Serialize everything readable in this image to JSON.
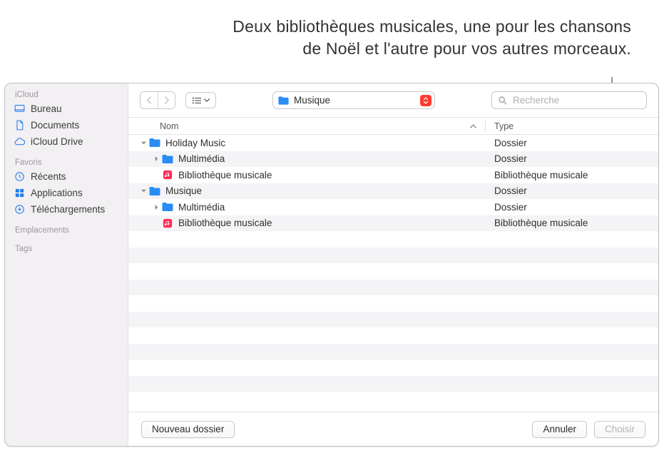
{
  "annotation": "Deux bibliothèques musicales, une pour les chansons de Noël et l'autre pour vos autres morceaux.",
  "sidebar": {
    "sections": [
      {
        "label": "iCloud",
        "items": [
          {
            "id": "bureau",
            "label": "Bureau",
            "icon": "desktop"
          },
          {
            "id": "documents",
            "label": "Documents",
            "icon": "doc"
          },
          {
            "id": "iclouddrive",
            "label": "iCloud Drive",
            "icon": "cloud"
          }
        ]
      },
      {
        "label": "Favoris",
        "items": [
          {
            "id": "recents",
            "label": "Récents",
            "icon": "clock"
          },
          {
            "id": "apps",
            "label": "Applications",
            "icon": "apps"
          },
          {
            "id": "downloads",
            "label": "Téléchargements",
            "icon": "download"
          }
        ]
      },
      {
        "label": "Emplacements",
        "items": []
      },
      {
        "label": "Tags",
        "items": []
      }
    ]
  },
  "toolbar": {
    "path_label": "Musique",
    "search_placeholder": "Recherche"
  },
  "columns": {
    "name": "Nom",
    "type": "Type"
  },
  "rows": [
    {
      "indent": 0,
      "disclosure": "down",
      "icon": "folder",
      "name": "Holiday Music",
      "type": "Dossier"
    },
    {
      "indent": 1,
      "disclosure": "right",
      "icon": "folder",
      "name": "Multimédia",
      "type": "Dossier"
    },
    {
      "indent": 1,
      "disclosure": "none",
      "icon": "musicdb",
      "name": "Bibliothèque musicale",
      "type": "Bibliothèque musicale"
    },
    {
      "indent": 0,
      "disclosure": "down",
      "icon": "folder",
      "name": "Musique",
      "type": "Dossier"
    },
    {
      "indent": 1,
      "disclosure": "right",
      "icon": "folder",
      "name": "Multimédia",
      "type": "Dossier"
    },
    {
      "indent": 1,
      "disclosure": "none",
      "icon": "musicdb",
      "name": "Bibliothèque musicale",
      "type": "Bibliothèque musicale"
    }
  ],
  "footer": {
    "new_folder": "Nouveau dossier",
    "cancel": "Annuler",
    "choose": "Choisir"
  }
}
